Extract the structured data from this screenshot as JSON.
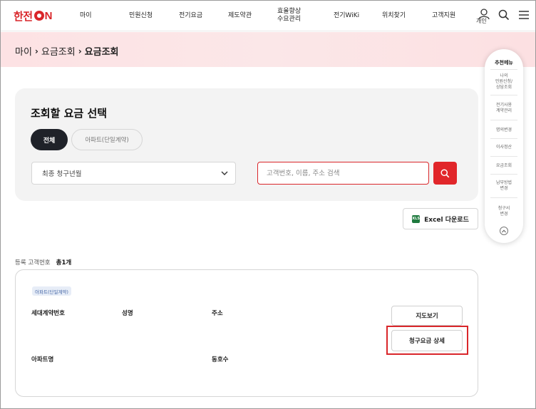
{
  "header": {
    "logo": {
      "pre": "한전",
      "post": "N"
    },
    "nav": [
      {
        "label": "마이"
      },
      {
        "label": "민원신청"
      },
      {
        "label": "전기요금"
      },
      {
        "label": "제도약관"
      },
      {
        "label": "효율향상\n수요관리"
      },
      {
        "label": "전기WiKi"
      },
      {
        "label": "위치찾기"
      },
      {
        "label": "고객지원"
      }
    ],
    "user_label": "개인"
  },
  "breadcrumb": {
    "items": [
      "마이",
      "요금조회",
      "요금조회"
    ],
    "separator": "›"
  },
  "selection": {
    "title": "조회할 요금 선택",
    "tabs": [
      {
        "label": "전체",
        "active": true
      },
      {
        "label": "아파트(단일계약)",
        "active": false
      }
    ],
    "select_value": "최종 청구년월",
    "search_placeholder": "고객번호, 이름, 주소 검색"
  },
  "excel_button": {
    "icon": "XLS",
    "label": "Excel 다운로드"
  },
  "count": {
    "label": "등록 고객번호",
    "total": "총1개"
  },
  "card": {
    "badge": "아파트(단일계약)",
    "fields": {
      "household_no": "세대계약번호",
      "name": "성명",
      "address": "주소",
      "apartment": "아파트명",
      "unit": "동호수"
    },
    "map_button": "지도보기",
    "detail_button": "청구요금 상세"
  },
  "quick_menu": {
    "title": "추천메뉴",
    "items": [
      "나의\n민원신청/\n상담조회",
      "전기사용\n계약관리",
      "명의변경",
      "이사정산",
      "요금조회",
      "납부방법\n변경",
      "청구서\n변경"
    ]
  },
  "colors": {
    "brand_red": "#d9262a",
    "dark_tab": "#1f2229",
    "banner_pink": "#fde2e4",
    "excel_green": "#1f7a3e"
  }
}
